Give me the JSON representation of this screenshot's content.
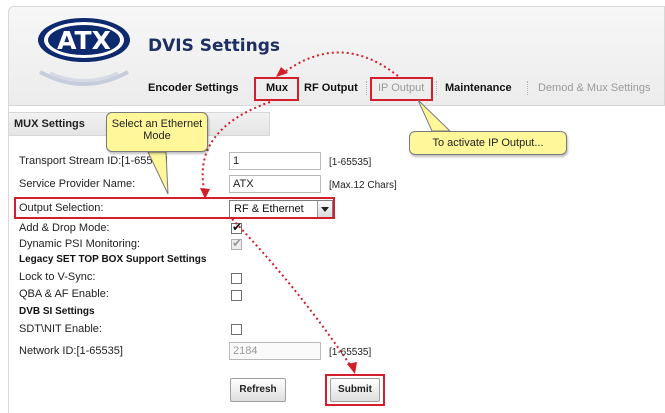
{
  "app": {
    "logo_text": "ATX",
    "title": "DVIS Settings"
  },
  "tabs": [
    {
      "label": "Encoder Settings",
      "state": "normal"
    },
    {
      "label": "Mux",
      "state": "active"
    },
    {
      "label": "RF Output",
      "state": "normal"
    },
    {
      "label": "IP Output",
      "state": "disabled"
    },
    {
      "label": "Maintenance",
      "state": "normal"
    },
    {
      "label": "Demod & Mux Settings",
      "state": "disabled"
    }
  ],
  "panel": {
    "title": "MUX Settings"
  },
  "form": {
    "transport_stream_id": {
      "label": "Transport Stream ID:[1-65535]",
      "value": "1",
      "hint": "[1-65535]"
    },
    "service_provider_name": {
      "label": "Service Provider Name:",
      "value": "ATX",
      "hint": "[Max.12 Chars]"
    },
    "output_selection": {
      "label": "Output Selection:",
      "value": "RF & Ethernet"
    },
    "add_drop_mode": {
      "label": "Add & Drop Mode:",
      "checked": true
    },
    "dynamic_psi_monitoring": {
      "label": "Dynamic PSI Monitoring:",
      "checked": true,
      "disabled": true
    },
    "legacy_section": "Legacy SET TOP BOX Support Settings",
    "lock_to_vsync": {
      "label": "Lock to V-Sync:",
      "checked": false
    },
    "qba_af_enable": {
      "label": "QBA & AF Enable:",
      "checked": false
    },
    "dvb_si_section": "DVB SI Settings",
    "sdt_nit_enable": {
      "label": "SDT\\NIT Enable:",
      "checked": false
    },
    "network_id": {
      "label": "Network ID:[1-65535]",
      "value": "2184",
      "hint": "[1-65535]",
      "disabled": true
    }
  },
  "buttons": {
    "refresh": "Refresh",
    "submit": "Submit"
  },
  "callouts": {
    "ethernet_mode": "Select an Ethernet Mode",
    "activate_ip": "To activate IP Output..."
  },
  "colors": {
    "highlight": "#d21f2b",
    "callout_bg": "#fff79a",
    "title_color": "#1d2f63"
  }
}
